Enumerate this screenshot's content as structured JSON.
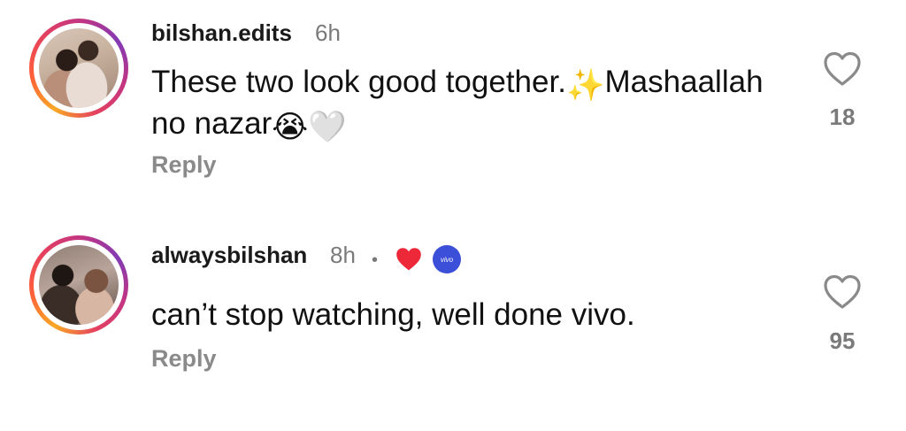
{
  "comments": [
    {
      "username": "bilshan.edits",
      "time": "6h",
      "text_line1": "These two look good together.",
      "text_emoji_sparkles": "✨",
      "text_line1_rest": "Mashaallah",
      "text_line2": "no nazar",
      "text_emoji_cry": "😭",
      "text_emoji_heart": "🤍",
      "reply_label": "Reply",
      "like_count": "18",
      "like_icon": "heart-outline-icon"
    },
    {
      "username": "alwaysbilshan",
      "time": "8h",
      "separator": "•",
      "liked_by_creator_icon": "red-heart-icon",
      "creator_badge_text": "vivo",
      "creator_badge_color": "#3b4fd8",
      "text": "can’t stop watching, well done vivo.",
      "reply_label": "Reply",
      "like_count": "95",
      "like_icon": "heart-outline-icon"
    }
  ],
  "colors": {
    "text_primary": "#111111",
    "text_secondary": "#7a7a7a",
    "reply": "#8a8a8a",
    "liked_heart": "#ed2939"
  }
}
